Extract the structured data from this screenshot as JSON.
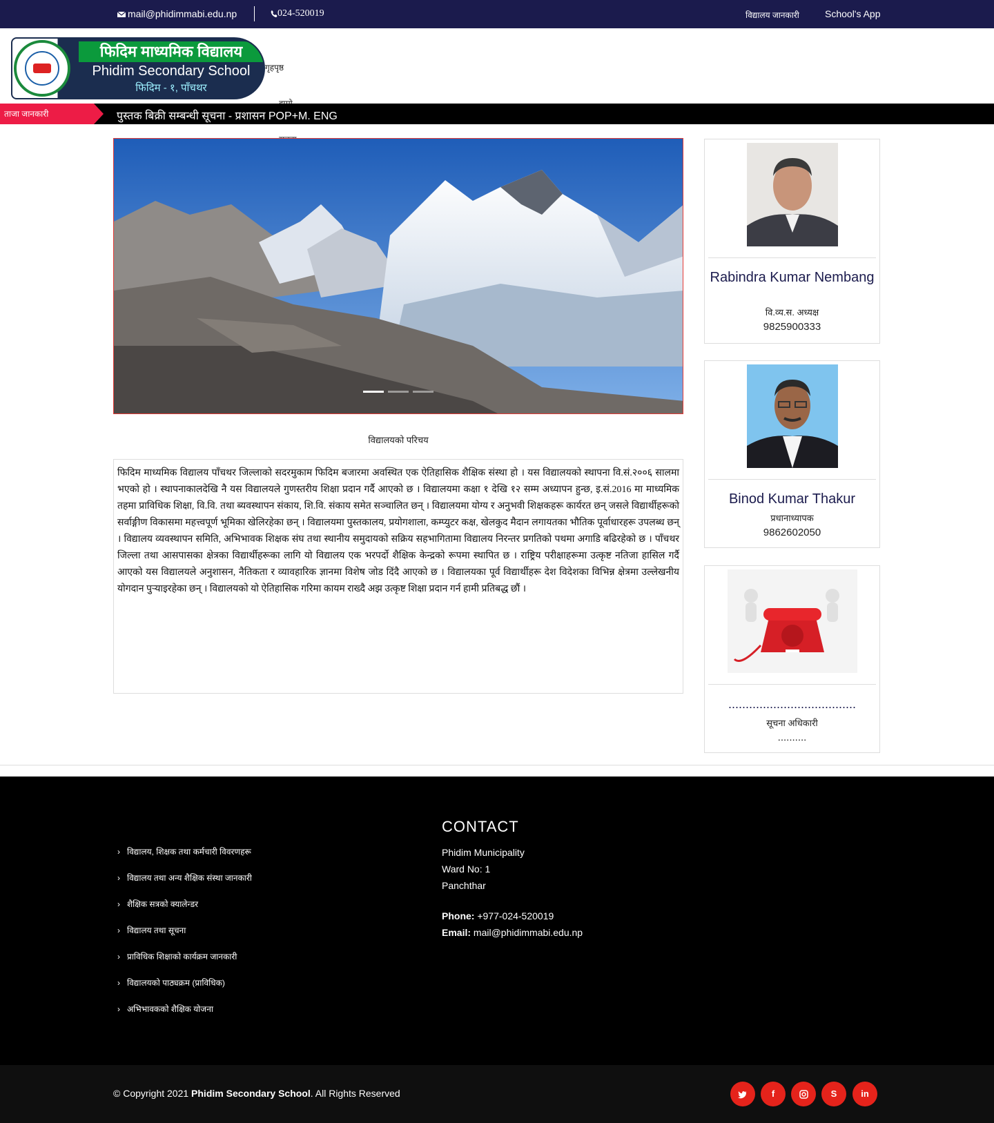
{
  "topbar": {
    "email": "mail@phidimmabi.edu.np",
    "phone": "024-520019",
    "link_devanagari": "विद्यालय जानकारी",
    "app": "School's App"
  },
  "header": {
    "logo_line1": "फिदिम माध्यमिक विद्यालय",
    "logo_line2": "Phidim Secondary School",
    "logo_line3": "फिदिम - १, पाँचथर",
    "nav": [
      "गृहपृष्ठ",
      "हाम्रो",
      "सूचना"
    ]
  },
  "ticker": {
    "label": "ताजा जानकारी",
    "text": "पुस्तक बिक्री सम्बन्धी सूचना - प्रशासन POP+M. ENG"
  },
  "slider": {
    "slides": 3,
    "active": 1
  },
  "about": {
    "title": "विद्यालयको परिचय",
    "body": "फिदिम माध्यमिक विद्यालय पाँचथर जिल्लाको सदरमुकाम फिदिम बजारमा अवस्थित एक ऐतिहासिक शैक्षिक संस्था हो । यस विद्यालयको स्थापना वि.सं.२००६ सालमा भएको हो । स्थापनाकालदेखि नै यस विद्यालयले गुणस्तरीय शिक्षा प्रदान गर्दै आएको छ । विद्यालयमा कक्षा १ देखि १२ सम्म अध्यापन हुन्छ, इ.सं.2016 मा माध्यमिक तहमा प्राविधिक शिक्षा, वि.वि. तथा ब्यवस्थापन संकाय, शि.वि. संकाय समेत सञ्चालित छन् । विद्यालयमा योग्य र अनुभवी शिक्षकहरू कार्यरत छन् जसले विद्यार्थीहरूको सर्वाङ्गीण विकासमा महत्त्वपूर्ण भूमिका खेलिरहेका छन् । विद्यालयमा पुस्तकालय, प्रयोगशाला, कम्प्युटर कक्ष, खेलकुद मैदान लगायतका भौतिक पूर्वाधारहरू उपलब्ध छन् । विद्यालय व्यवस्थापन समिति, अभिभावक शिक्षक संघ तथा स्थानीय समुदायको सक्रिय सहभागितामा विद्यालय निरन्तर प्रगतिको पथमा अगाडि बढिरहेको छ । पाँचथर जिल्ला तथा आसपासका क्षेत्रका विद्यार्थीहरूका लागि यो विद्यालय एक भरपर्दो शैक्षिक केन्द्रको रूपमा स्थापित छ । राष्ट्रिय परीक्षाहरूमा उत्कृष्ट नतिजा हासिल गर्दै आएको यस विद्यालयले अनुशासन, नैतिकता र व्यावहारिक ज्ञानमा विशेष जोड दिंदै आएको छ । विद्यालयका पूर्व विद्यार्थीहरू देश विदेशका विभिन्न क्षेत्रमा उल्लेखनीय योगदान पुर्‍याइरहेका छन् । विद्यालयको यो ऐतिहासिक गरिमा कायम राख्दै अझ उत्कृष्ट शिक्षा प्रदान गर्न हामी प्रतिबद्ध छौं ।"
  },
  "staff": [
    {
      "name": "Rabindra Kumar Nembang",
      "role": "वि.व्य.स. अध्यक्ष",
      "phone": "9825900333"
    },
    {
      "name": "Binod Kumar Thakur",
      "role": "प्रधानाध्यापक",
      "phone": "9862602050"
    },
    {
      "name": ".....................................",
      "role": "सूचना अधिकारी",
      "phone": ".........."
    }
  ],
  "footer": {
    "links": [
      "विद्यालय, शिक्षक तथा कर्मचारी विवरणहरू",
      "विद्यालय तथा अन्य शैक्षिक संस्था जानकारी",
      "शैक्षिक सत्रको क्यालेन्डर",
      "विद्यालय तथा सूचना",
      "प्राविधिक शिक्षाको कार्यक्रम जानकारी",
      "विद्यालयको पाठ्यक्रम (प्राविधिक)",
      "अभिभावकको शैक्षिक योजना"
    ],
    "contact_heading": "CONTACT",
    "address": [
      "Phidim Municipality",
      "Ward No: 1",
      "Panchthar"
    ],
    "phone_label": "Phone:",
    "phone": "+977-024-520019",
    "email_label": "Email:",
    "email": "mail@phidimmabi.edu.np"
  },
  "copyright": {
    "prefix": "© Copyright 2021 ",
    "name": "Phidim Secondary School",
    "suffix": ". All Rights Reserved"
  },
  "social": [
    "twitter-icon",
    "facebook-icon",
    "instagram-icon",
    "skype-icon",
    "linkedin-icon"
  ],
  "colors": {
    "navy": "#1b1b4d",
    "accent_red": "#e5231b",
    "ticker_tag": "#ed1c46"
  }
}
